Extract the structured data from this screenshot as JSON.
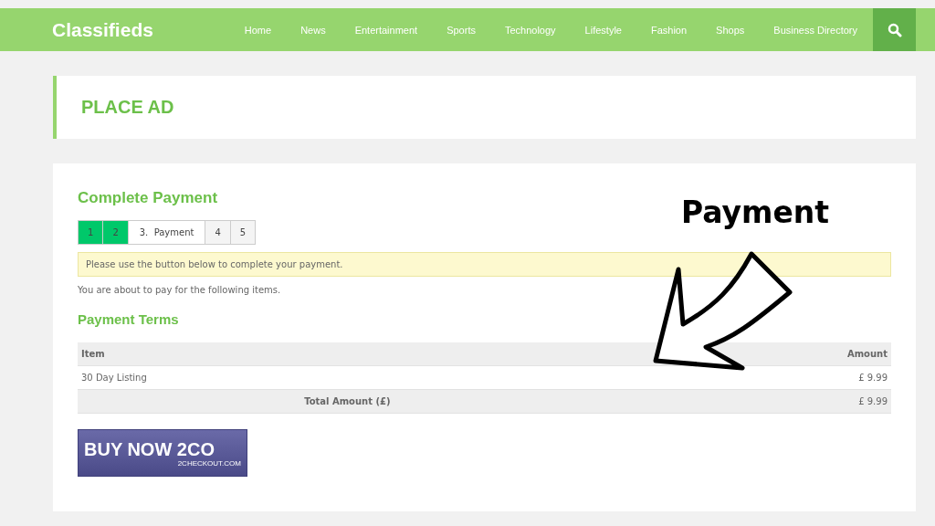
{
  "header": {
    "logo": "Classifieds",
    "nav": [
      {
        "label": "Home"
      },
      {
        "label": "News"
      },
      {
        "label": "Entertainment"
      },
      {
        "label": "Sports"
      },
      {
        "label": "Technology"
      },
      {
        "label": "Lifestyle"
      },
      {
        "label": "Fashion"
      },
      {
        "label": "Shops"
      },
      {
        "label": "Business Directory"
      }
    ]
  },
  "page_title": "PLACE AD",
  "payment": {
    "title": "Complete Payment",
    "steps": [
      {
        "label": "1",
        "done": true,
        "selected": false
      },
      {
        "label": "2",
        "done": true,
        "selected": false
      },
      {
        "label": "3.  Payment",
        "done": false,
        "selected": true
      },
      {
        "label": "4",
        "done": false,
        "selected": false
      },
      {
        "label": "5",
        "done": false,
        "selected": false
      }
    ],
    "notice": "Please use the button below to complete your payment.",
    "intro": "You are about to pay for the following items.",
    "terms_title": "Payment Terms",
    "table": {
      "columns": [
        "Item",
        "Amount"
      ],
      "rows": [
        [
          "30 Day Listing",
          "£ 9.99"
        ]
      ],
      "total": {
        "label": "Total Amount (£)",
        "value": "£ 9.99"
      }
    },
    "buy_button": {
      "label": "BUY NOW 2CO",
      "sub": "2CHECKOUT.COM"
    }
  },
  "annotation": {
    "label": "Payment"
  }
}
